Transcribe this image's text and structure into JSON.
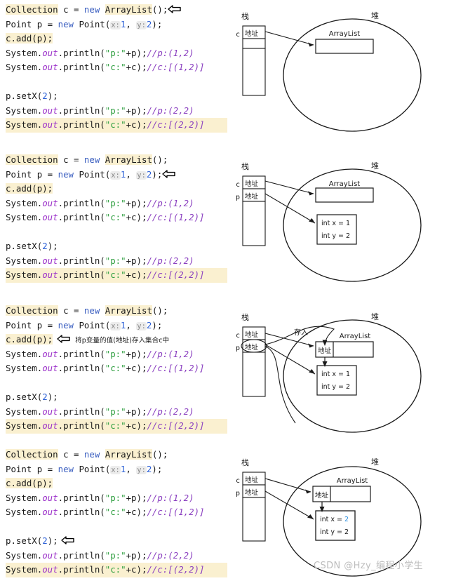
{
  "watermark": "CSDN @Hzy_编程小学生",
  "icons": {
    "left_arrow": "left-arrow-pointer-icon"
  },
  "colors": {
    "highlight_bg": "#faf0d0",
    "keyword": "#3b5fc0",
    "field": "#9b30c9",
    "string": "#2e9e3f",
    "comment": "#8a3fc0",
    "number": "#2a5fd6",
    "hint_bg": "#ececec",
    "hint_fg": "#8a8a8a",
    "diagram_stroke": "#1a1a1a",
    "changed_value": "#2a8fe0"
  },
  "code": {
    "line1": {
      "type": "Collection",
      "var": " c = ",
      "new": "new",
      "ctor": "ArrayList",
      "tail": "();"
    },
    "line2": {
      "type": "Point p = ",
      "new": "new",
      "ctor": " Point(",
      "hint_x": "x:",
      "val_x": "1",
      "sep": ", ",
      "hint_y": "y:",
      "val_y": "2",
      "tail": ");"
    },
    "line3": {
      "text": "c.add(p);"
    },
    "line4": {
      "pre": "System.",
      "field": "out",
      "mid": ".println(",
      "str": "\"p:\"",
      "args": "+p);",
      "cmt": "//p:(1,2)"
    },
    "line5": {
      "pre": "System.",
      "field": "out",
      "mid": ".println(",
      "str": "\"c:\"",
      "args": "+c);",
      "cmt": "//c:[(1,2)]"
    },
    "line7": {
      "pre": "p.setX(",
      "num": "2",
      "tail": ");"
    },
    "line8": {
      "pre": "System.",
      "field": "out",
      "mid": ".println(",
      "str": "\"p:\"",
      "args": "+p);",
      "cmt": "//p:(2,2)"
    },
    "line9": {
      "pre": "System.",
      "field": "out",
      "mid": ".println(",
      "str": "\"c:\"",
      "args": "+c);",
      "cmt": "//c:[(2,2)]"
    }
  },
  "annotations": {
    "panel3_note": "将p变量的值(地址)存入集合c中"
  },
  "diagram": {
    "stack_label": "栈",
    "heap_label": "堆",
    "var_c": "c",
    "var_p": "p",
    "address": "地址",
    "arraylist_label": "ArrayList",
    "store_label": "存入",
    "point_x_label": "int x = ",
    "point_y_label": "int y = ",
    "x_val_1": "1",
    "y_val_2": "2",
    "x_val_2": "2"
  },
  "panels": [
    {
      "id": "panel-1",
      "pointer_line": "line1",
      "has_note": false,
      "diagram": {
        "show_p": false,
        "show_point": false,
        "show_stored_addr": false,
        "x_changed": false
      }
    },
    {
      "id": "panel-2",
      "pointer_line": "line2",
      "has_note": false,
      "diagram": {
        "show_p": true,
        "show_point": true,
        "show_stored_addr": false,
        "x_changed": false
      }
    },
    {
      "id": "panel-3",
      "pointer_line": "line3",
      "has_note": true,
      "diagram": {
        "show_p": true,
        "show_point": true,
        "show_stored_addr": true,
        "x_changed": false
      }
    },
    {
      "id": "panel-4",
      "pointer_line": "line7",
      "has_note": false,
      "diagram": {
        "show_p": true,
        "show_point": true,
        "show_stored_addr": true,
        "x_changed": true
      }
    }
  ]
}
